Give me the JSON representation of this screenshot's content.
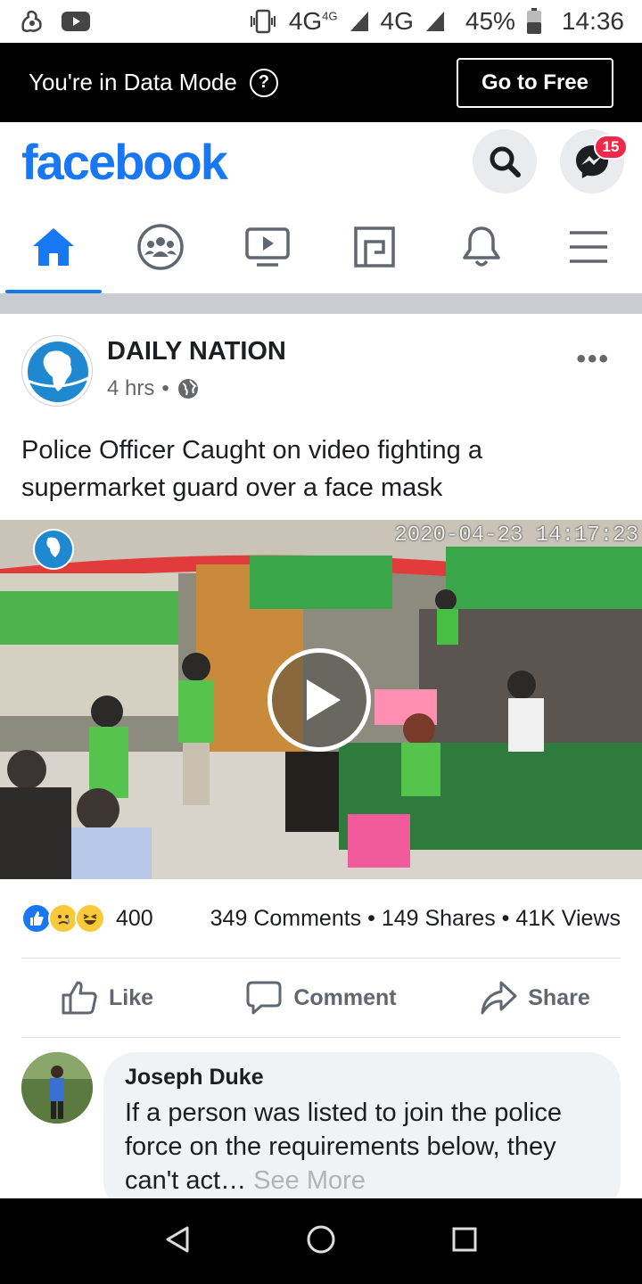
{
  "status_bar": {
    "network_1": "4G",
    "network_1_sup": "4G",
    "network_2": "4G",
    "battery": "45%",
    "time": "14:36"
  },
  "data_mode": {
    "message": "You're in Data Mode",
    "help_icon": "?",
    "button_label": "Go to Free"
  },
  "header": {
    "logo": "facebook",
    "messenger_badge": "15"
  },
  "colors": {
    "brand": "#1877f2",
    "badge": "#f02849"
  },
  "tabs": [
    {
      "name": "home",
      "icon": "home-icon",
      "active": true
    },
    {
      "name": "groups",
      "icon": "groups-icon",
      "active": false
    },
    {
      "name": "watch",
      "icon": "video-icon",
      "active": false
    },
    {
      "name": "marketplace",
      "icon": "pages-icon",
      "active": false
    },
    {
      "name": "notifications",
      "icon": "bell-icon",
      "active": false
    },
    {
      "name": "menu",
      "icon": "menu-icon",
      "active": false
    }
  ],
  "post": {
    "page_name": "DAILY NATION",
    "time": "4 hrs",
    "separator": "•",
    "text": "Police Officer Caught on video fighting a supermarket guard over a face mask",
    "video_timestamp": "2020-04-23 14:17:23",
    "reaction_count": "400",
    "stats": "349 Comments • 149 Shares • 41K Views",
    "actions": {
      "like": "Like",
      "comment": "Comment",
      "share": "Share"
    }
  },
  "comment": {
    "author": "Joseph Duke",
    "text": "If a person was listed to join the police force on the requirements below, they can't act…",
    "see_more": "See More"
  }
}
